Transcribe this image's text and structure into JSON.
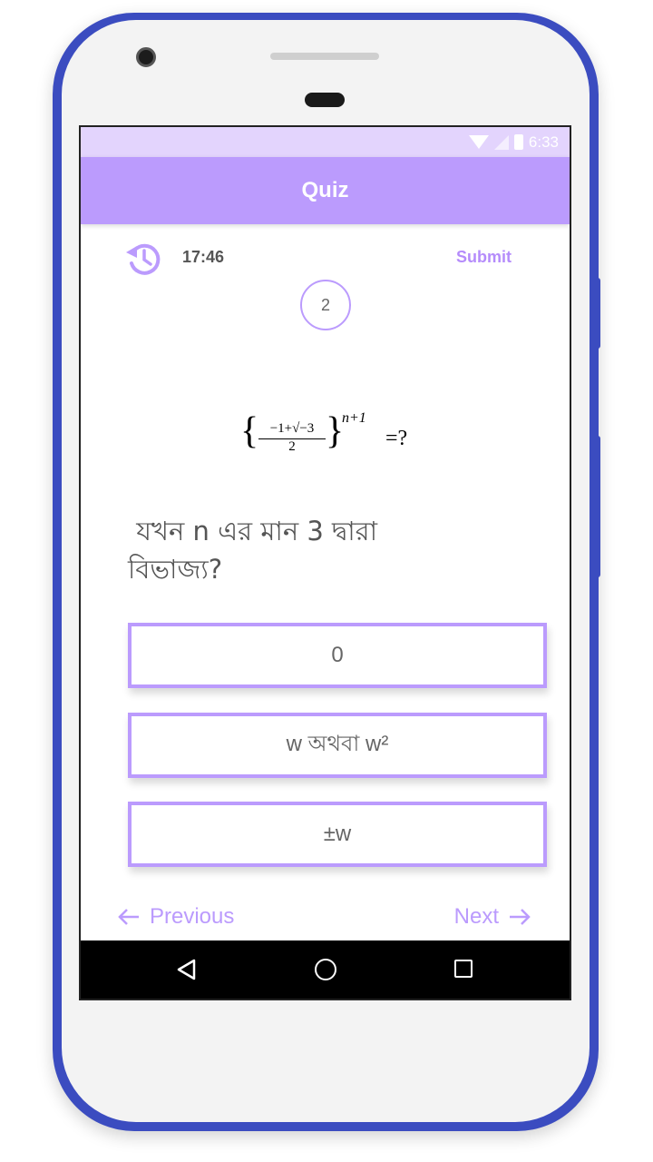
{
  "status_bar": {
    "time": "6:33"
  },
  "app_bar": {
    "title": "Quiz"
  },
  "quiz": {
    "timer": "17:46",
    "submit_label": "Submit",
    "question_number": "2",
    "formula": {
      "numerator": "−1+√−3",
      "denominator": "2",
      "exponent": "n+1",
      "suffix": "=?"
    },
    "question_text": " যখন n এর মান 3 দ্বারা\nবিভাজ্য?",
    "options": [
      "0",
      "w অথবা w²",
      "±w"
    ]
  },
  "navigation": {
    "previous_label": "Previous",
    "next_label": "Next"
  },
  "colors": {
    "accent": "#bb9bfd",
    "status_bar": "#e3d4fd",
    "device_frame": "#3b4cc0"
  },
  "icons": {
    "history": "history-icon",
    "prev_arrow": "arrow-left-icon",
    "next_arrow": "arrow-right-icon"
  }
}
